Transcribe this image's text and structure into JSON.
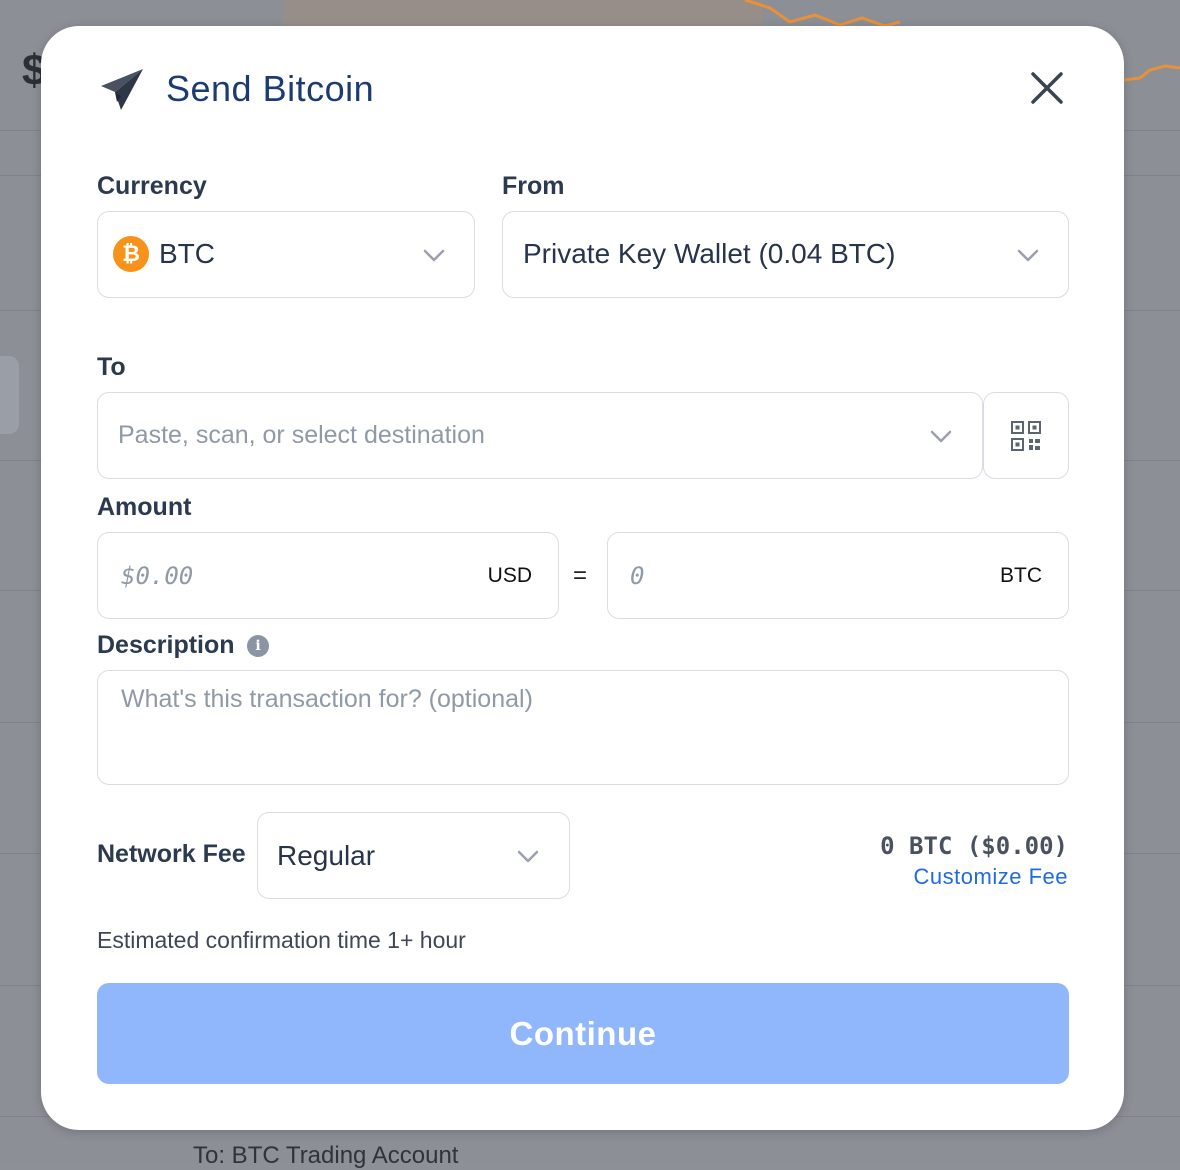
{
  "background": {
    "dollar_sign": "$",
    "footer_text": "To: BTC Trading Account",
    "chart_color": "#e8913a"
  },
  "modal": {
    "title": "Send Bitcoin",
    "icons": {
      "title": "paper-plane-icon",
      "close": "close-icon"
    }
  },
  "currency": {
    "label": "Currency",
    "value": "BTC",
    "coin_symbol": "₿",
    "coin_color": "#f7931a"
  },
  "from": {
    "label": "From",
    "value": "Private Key Wallet (0.04 BTC)"
  },
  "to": {
    "label": "To",
    "placeholder": "Paste, scan, or select destination",
    "scan_icon": "qr-code-icon"
  },
  "amount": {
    "label": "Amount",
    "usd_placeholder": "$0.00",
    "usd_unit": "USD",
    "equals": "=",
    "btc_placeholder": "0",
    "btc_unit": "BTC"
  },
  "description": {
    "label": "Description",
    "info_glyph": "i",
    "placeholder": "What's this transaction for? (optional)"
  },
  "network_fee": {
    "label": "Network Fee",
    "selected": "Regular",
    "amount": "0 BTC ($0.00)",
    "customize_label": "Customize Fee"
  },
  "estimate": {
    "text": "Estimated confirmation time 1+ hour"
  },
  "actions": {
    "continue_label": "Continue",
    "continue_color": "#90b7fb"
  }
}
